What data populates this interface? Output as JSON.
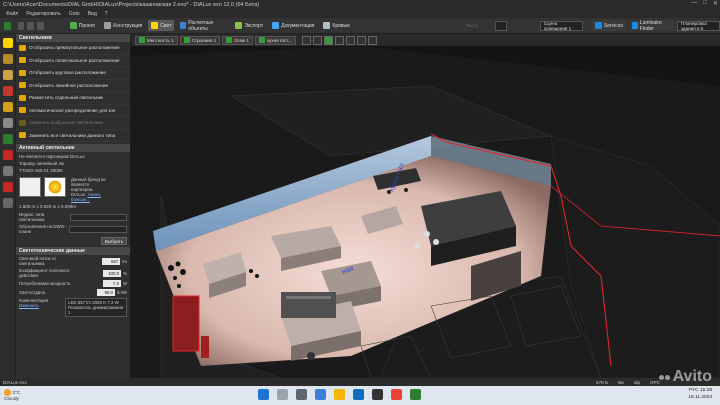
{
  "window": {
    "title": "C:\\Users\\Acer\\Documents\\DIAL GmbH\\DIALux\\Projects\\казановская 2.evo* - DIALux evo 12.0  (64 Бита)",
    "controls": [
      "—",
      "□",
      "✕"
    ]
  },
  "menu": [
    "Файл",
    "Редактировать",
    "Goto",
    "Вид",
    "?"
  ],
  "ribbon": {
    "buttons": [
      {
        "label": "Проект",
        "icon": "project-icon",
        "color": "#4caf50"
      },
      {
        "label": "Конструкция",
        "icon": "construction-icon",
        "color": "#9e9e9e"
      },
      {
        "label": "Свет",
        "icon": "light-icon",
        "color": "#ffd400",
        "active": true
      },
      {
        "label": "Расчетные объекты",
        "icon": "calc-objects-icon",
        "color": "#3f7fd6"
      },
      {
        "label": "Экспорт",
        "icon": "export-icon",
        "color": "#8bc34a"
      },
      {
        "label": "Документация",
        "icon": "documentation-icon",
        "color": "#42a5f5"
      },
      {
        "label": "Кривые",
        "icon": "curves-icon",
        "color": "#b0bec5"
      }
    ],
    "dimmed_label": "Растр",
    "scene_select": "Сцена освещения 1",
    "services": "Services",
    "luminaire_finder": "Luminaire Finder",
    "plan_select": "Планировка здания и в",
    "entry_select": "Вход в систему"
  },
  "panel": {
    "header": "Светильники",
    "items": [
      {
        "label": "Отобразить прямоугольное расположение",
        "icon": "rect-arrangement-icon",
        "enabled": true
      },
      {
        "label": "Отобразить полигональное расположение",
        "icon": "polygon-arrangement-icon",
        "enabled": true
      },
      {
        "label": "Отобразить круговое расположение",
        "icon": "circle-arrangement-icon",
        "enabled": true
      },
      {
        "label": "Отобразить линейное расположение",
        "icon": "line-arrangement-icon",
        "enabled": true
      },
      {
        "label": "Разместить отдельный светильник",
        "icon": "single-luminaire-icon",
        "enabled": true
      },
      {
        "label": "Автоматическое распределение для зон",
        "icon": "auto-distribution-icon",
        "enabled": true
      },
      {
        "label": "Заменить выбранные светильники",
        "icon": "replace-selected-icon",
        "enabled": false
      },
      {
        "label": "Заменить все светильники данного типа",
        "icon": "replace-all-icon",
        "enabled": true
      }
    ],
    "active_header": "Активный светильник",
    "maker": "Не является партнером DIALux",
    "product": "Торшер линейный лю",
    "article": "TTAED-150-01 3000К",
    "note1": "Данный бренд не является партнером DIALux.",
    "note2": "Узнать больше...",
    "dimensions": "1.500 m x 0.020 m x 0.009m",
    "index_label": "Индекс типа светильника",
    "dwg_label": "Обозначения на DWG-плане",
    "select_button": "Выбрать",
    "data_header": "Светотехнические данные",
    "fields": [
      {
        "label": "Световой поток от светильника",
        "value": "657",
        "unit": "lm"
      },
      {
        "label": "Коэффициент полезного действия",
        "value": "100.0",
        "unit": "%"
      },
      {
        "label": "Потребляемая мощность",
        "value": "7.3",
        "unit": "W"
      },
      {
        "label": "Светоотдача",
        "value": "90.0",
        "unit": "lm/W"
      }
    ],
    "config_label": "Комплектация",
    "config_link": "Изменить",
    "config_value": "LED 657 lm 3000 K 7.3 W",
    "config_dimmable": "Показатель диммирования 1"
  },
  "viewport_tabs": [
    {
      "label": "Местность 1"
    },
    {
      "label": "Строение 1"
    },
    {
      "label": "Этаж 1"
    },
    {
      "label": "кухня гост..."
    }
  ],
  "scene_labels": [
    "кухня гост",
    "ная"
  ],
  "status": {
    "left": "DIALux evo",
    "right": [
      "578 lx",
      "Би",
      "dip",
      "OPC"
    ]
  },
  "taskbar": {
    "weather_temp": "3°C",
    "weather_desc": "Cloudy",
    "lang": "РУС",
    "time": "15:28",
    "date": "18.11.2023"
  },
  "watermark": "Avito"
}
